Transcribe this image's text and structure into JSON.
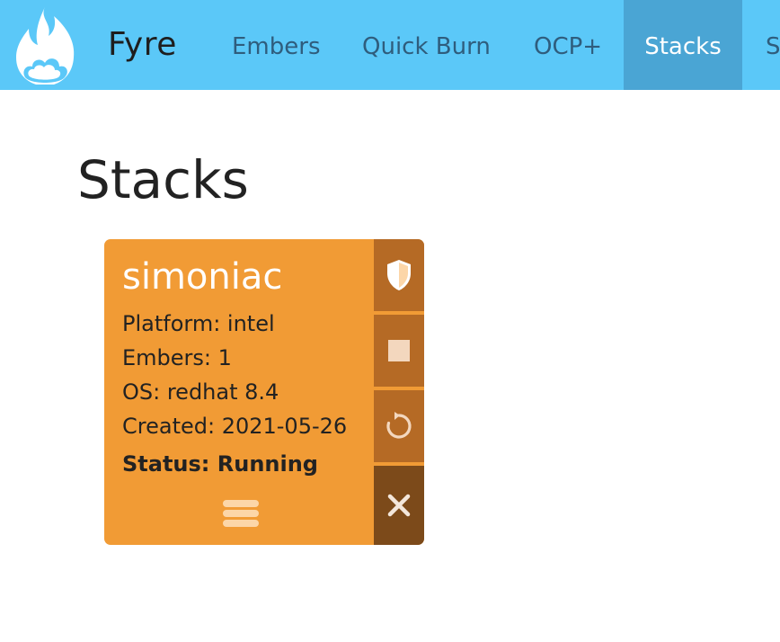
{
  "app": {
    "brand": "Fyre"
  },
  "nav": {
    "items": [
      {
        "label": "Embers",
        "active": false
      },
      {
        "label": "Quick Burn",
        "active": false
      },
      {
        "label": "OCP+",
        "active": false
      },
      {
        "label": "Stacks",
        "active": true
      },
      {
        "label": "S",
        "active": false
      }
    ]
  },
  "page": {
    "title": "Stacks"
  },
  "stack_card": {
    "name": "simoniac",
    "platform": "Platform: intel",
    "embers": "Embers: 1",
    "os": "OS: redhat 8.4",
    "created": "Created: 2021-05-26",
    "status": "Status: Running",
    "actions": [
      {
        "icon": "shield-icon"
      },
      {
        "icon": "stop-icon"
      },
      {
        "icon": "restart-icon"
      },
      {
        "icon": "close-icon"
      }
    ]
  },
  "colors": {
    "navbar": "#5bc8f8",
    "nav_active": "#4aa5d4",
    "nav_text": "#2f5d7d",
    "card": "#f19b35",
    "card_action": "#b56a25",
    "card_delete": "#7c4a1a"
  }
}
